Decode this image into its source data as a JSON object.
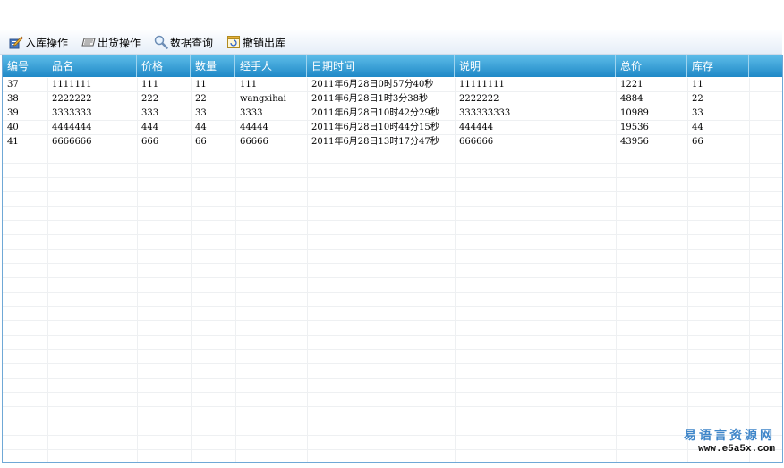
{
  "toolbar": {
    "stock_in": "入库操作",
    "ship_out": "出货操作",
    "query": "数据查询",
    "cancel_out": "撤销出库"
  },
  "table": {
    "columns": [
      "编号",
      "品名",
      "价格",
      "数量",
      "经手人",
      "日期时间",
      "说明",
      "总价",
      "库存"
    ],
    "rows": [
      [
        "37",
        "1111111",
        "111",
        "11",
        "111",
        "2011年6月28日0时57分40秒",
        "11111111",
        "1221",
        "11"
      ],
      [
        "38",
        "2222222",
        "222",
        "22",
        "wangxihai",
        "2011年6月28日1时3分38秒",
        "2222222",
        "4884",
        "22"
      ],
      [
        "39",
        "3333333",
        "333",
        "33",
        "3333",
        "2011年6月28日10时42分29秒",
        "333333333",
        "10989",
        "33"
      ],
      [
        "40",
        "4444444",
        "444",
        "44",
        "44444",
        "2011年6月28日10时44分15秒",
        "444444",
        "19536",
        "44"
      ],
      [
        "41",
        "6666666",
        "666",
        "66",
        "66666",
        "2011年6月28日13时17分47秒",
        "666666",
        "43956",
        "66"
      ]
    ]
  },
  "watermark": {
    "cn": "易语言资源网",
    "url": "www.e5a5x.com"
  },
  "icons": [
    "pencil-book-icon",
    "card-icon",
    "magnifier-icon",
    "undo-box-icon"
  ],
  "colors": {
    "header_bg": "#2d98d1",
    "border": "#6fa8d6",
    "watermark": "#3f86c9"
  }
}
